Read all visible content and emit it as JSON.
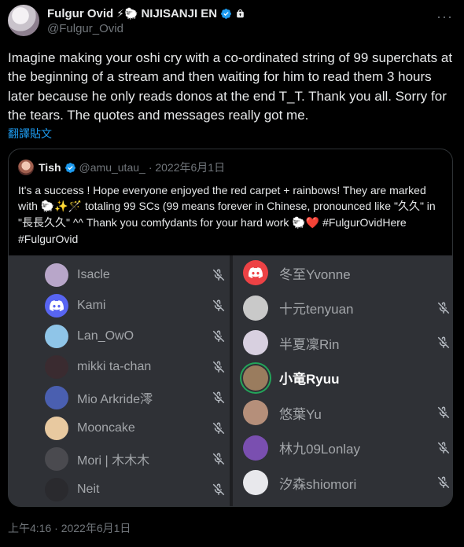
{
  "author": {
    "name": "Fulgur Ovid",
    "emojis": "⚡🐑",
    "org": "NIJISANJI EN",
    "handle": "@Fulgur_Ovid"
  },
  "tweet": {
    "text": "Imagine making your oshi cry with a co-ordinated string of 99 superchats at the beginning of a stream and then waiting for him to read them 3 hours later because he only reads donos at the end T_T. Thank you all. Sorry for the tears. The quotes and messages really got me.",
    "translate_label": "翻譯貼文",
    "timestamp": "上午4:16 · 2022年6月1日"
  },
  "quote": {
    "name": "Tish",
    "handle": "@amu_utau_",
    "date": "· 2022年6月1日",
    "text_1": "It's a success ! Hope everyone enjoyed the red carpet + rainbows! They are marked with ",
    "emoji_marks": "🐑✨🪄",
    "text_2": " totaling 99 SCs (99 means forever in Chinese, pronounced like \"久久\" in \"長長久久\" ^^ Thank you comfydants for your hard work ",
    "emoji_end": "🐑",
    "heart": "❤️",
    "hashtags": " #FulgurOvidHere #FulgurOvid"
  },
  "discord": {
    "left": [
      {
        "name": "Isacle",
        "avatar_color": "#b8a6c9"
      },
      {
        "name": "Kami",
        "avatar_color": "#5865f2"
      },
      {
        "name": "Lan_OwO",
        "avatar_color": "#8fc5e8"
      },
      {
        "name": "mikki ta-chan",
        "avatar_color": "#3a2b30"
      },
      {
        "name": "Mio Arkride澪",
        "avatar_color": "#4a5fb0"
      },
      {
        "name": "Mooncake",
        "avatar_color": "#e8c9a0"
      },
      {
        "name": "Mori | 木木木",
        "avatar_color": "#4a4a4f"
      },
      {
        "name": "Neit",
        "avatar_color": "#2a2a2e"
      }
    ],
    "right": [
      {
        "name": "冬至Yvonne",
        "avatar_color": "#ed4245"
      },
      {
        "name": "十元tenyuan",
        "avatar_color": "#c9c9c9"
      },
      {
        "name": "半夏凜Rin",
        "avatar_color": "#d8d0e0"
      },
      {
        "name": "小竜Ryuu",
        "avatar_color": "#9a7c5e",
        "active": true
      },
      {
        "name": "悠葉Yu",
        "avatar_color": "#b58f7a"
      },
      {
        "name": "林九09Lonlay",
        "avatar_color": "#7a4fb0"
      },
      {
        "name": "汐森shiomori",
        "avatar_color": "#e8e8ec"
      }
    ],
    "speaking_color": "#23a55a"
  },
  "colors": {
    "accent": "#1d9bf0",
    "muted": "#71767b",
    "discord_bg": "#2f3136"
  }
}
